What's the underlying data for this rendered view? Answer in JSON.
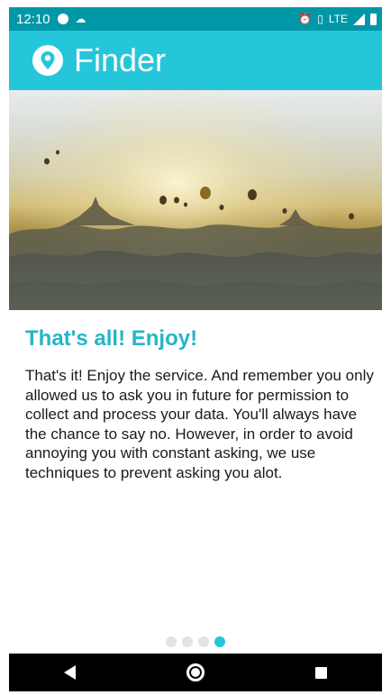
{
  "status_bar": {
    "time": "12:10",
    "network": "LTE",
    "icons": [
      "record-dot-icon",
      "cloud-icon",
      "alarm-icon",
      "vibrate-icon",
      "signal-icon",
      "battery-icon"
    ]
  },
  "app_bar": {
    "title": "Finder",
    "logo_icon": "location-pin-icon",
    "color": "#26c6da"
  },
  "hero": {
    "description_icon": "hot-air-balloons-landscape-image"
  },
  "content": {
    "title": "That's all! Enjoy!",
    "body": "That's it! Enjoy the service. And remember you only allowed us to ask you in future for permission to collect and process your data. You'll always have the chance to say no. However, in order to avoid annoying you with constant asking, we use techniques to prevent asking you alot."
  },
  "pager": {
    "total": 4,
    "current": 4,
    "active_color": "#26c6da"
  },
  "nav_bar": {
    "buttons": [
      "back",
      "home",
      "recents"
    ]
  }
}
